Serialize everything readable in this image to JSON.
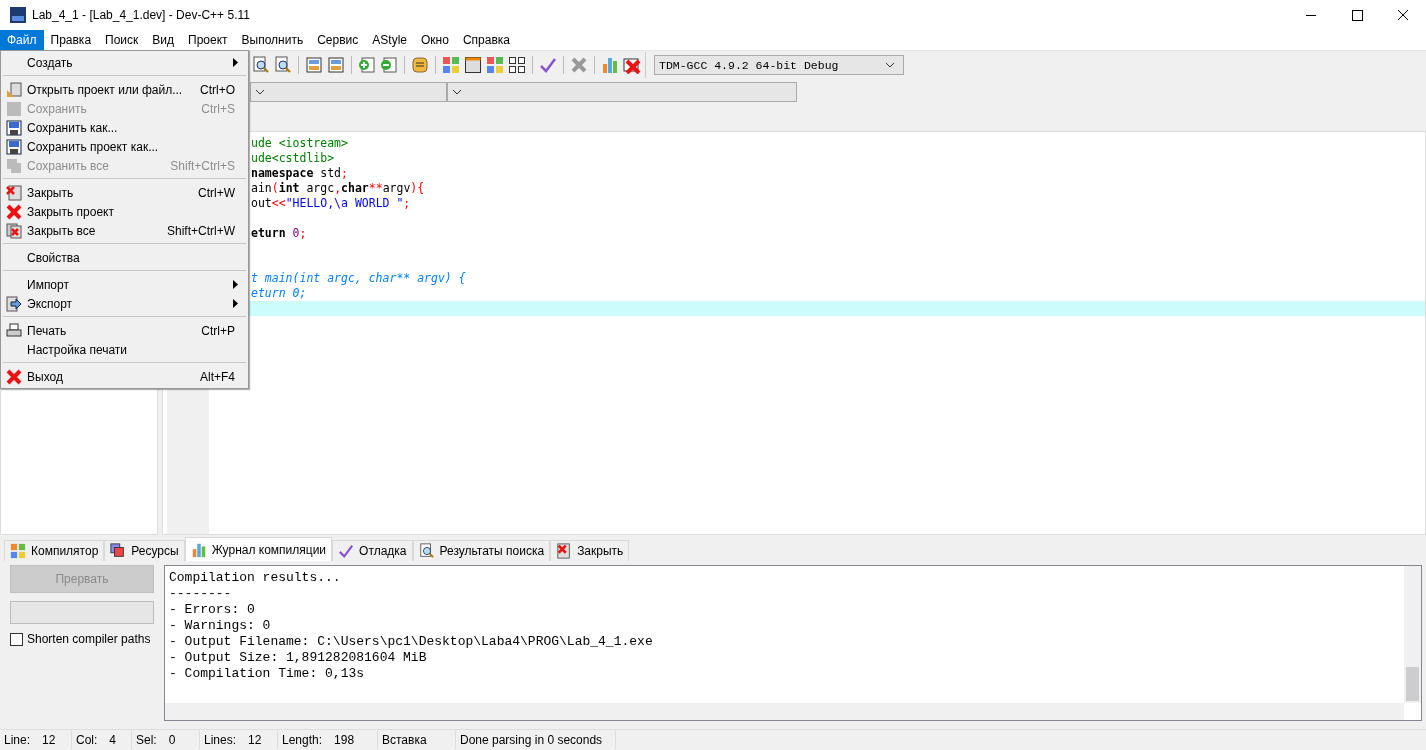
{
  "window": {
    "title": "Lab_4_1 - [Lab_4_1.dev] - Dev-C++ 5.11"
  },
  "menubar": [
    {
      "label": "Файл",
      "selected": true
    },
    {
      "label": "Правка",
      "selected": false
    },
    {
      "label": "Поиск",
      "selected": false
    },
    {
      "label": "Вид",
      "selected": false
    },
    {
      "label": "Проект",
      "selected": false
    },
    {
      "label": "Выполнить",
      "selected": false
    },
    {
      "label": "Сервис",
      "selected": false
    },
    {
      "label": "AStyle",
      "selected": false
    },
    {
      "label": "Окно",
      "selected": false
    },
    {
      "label": "Справка",
      "selected": false
    }
  ],
  "file_menu": [
    {
      "kind": "item",
      "label": "Создать",
      "disabled": false,
      "submenu": true
    },
    {
      "kind": "separator"
    },
    {
      "kind": "item",
      "label": "Открыть проект или файл...",
      "shortcut": "Ctrl+O",
      "disabled": false
    },
    {
      "kind": "item",
      "label": "Сохранить",
      "shortcut": "Ctrl+S",
      "disabled": true
    },
    {
      "kind": "item",
      "label": "Сохранить как...",
      "disabled": false
    },
    {
      "kind": "item",
      "label": "Сохранить проект как...",
      "disabled": false
    },
    {
      "kind": "item",
      "label": "Сохранить все",
      "shortcut": "Shift+Ctrl+S",
      "disabled": true
    },
    {
      "kind": "separator"
    },
    {
      "kind": "item",
      "label": "Закрыть",
      "shortcut": "Ctrl+W",
      "disabled": false
    },
    {
      "kind": "item",
      "label": "Закрыть проект",
      "disabled": false
    },
    {
      "kind": "item",
      "label": "Закрыть все",
      "shortcut": "Shift+Ctrl+W",
      "disabled": false
    },
    {
      "kind": "separator"
    },
    {
      "kind": "item",
      "label": "Свойства",
      "disabled": false
    },
    {
      "kind": "separator"
    },
    {
      "kind": "item",
      "label": "Импорт",
      "disabled": false,
      "submenu": true
    },
    {
      "kind": "item",
      "label": "Экспорт",
      "disabled": false,
      "submenu": true
    },
    {
      "kind": "separator"
    },
    {
      "kind": "item",
      "label": "Печать",
      "shortcut": "Ctrl+P",
      "disabled": false
    },
    {
      "kind": "item",
      "label": "Настройка печати",
      "disabled": false
    },
    {
      "kind": "separator"
    },
    {
      "kind": "item",
      "label": "Выход",
      "shortcut": "Alt+F4",
      "disabled": false
    }
  ],
  "toolbar": {
    "compiler": "TDM-GCC 4.9.2 64-bit Debug"
  },
  "editor": {
    "lines": [
      {
        "current": false,
        "tokens": [
          {
            "kind": "preproc",
            "text": "ude <iostream>"
          }
        ]
      },
      {
        "current": false,
        "tokens": [
          {
            "kind": "preproc",
            "text": "ude<cstdlib>"
          }
        ]
      },
      {
        "current": false,
        "tokens": [
          {
            "kind": "keyword",
            "text": "namespace"
          },
          {
            "kind": "plain",
            "text": " std"
          },
          {
            "kind": "symbol",
            "text": ";"
          }
        ]
      },
      {
        "current": false,
        "tokens": [
          {
            "kind": "plain",
            "text": "ain"
          },
          {
            "kind": "symbol",
            "text": "("
          },
          {
            "kind": "keyword",
            "text": "int"
          },
          {
            "kind": "plain",
            "text": " argc"
          },
          {
            "kind": "symbol",
            "text": ","
          },
          {
            "kind": "keyword",
            "text": "char"
          },
          {
            "kind": "symbol",
            "text": "**"
          },
          {
            "kind": "plain",
            "text": "argv"
          },
          {
            "kind": "symbol",
            "text": "){"
          }
        ]
      },
      {
        "current": false,
        "tokens": [
          {
            "kind": "plain",
            "text": "out"
          },
          {
            "kind": "symbol",
            "text": "<<"
          },
          {
            "kind": "string",
            "text": "\"HELLO,\\a WORLD \""
          },
          {
            "kind": "symbol",
            "text": ";"
          }
        ]
      },
      {
        "current": false
      },
      {
        "current": false,
        "tokens": [
          {
            "kind": "keyword",
            "text": "eturn"
          },
          {
            "kind": "number",
            "text": " 0"
          },
          {
            "kind": "symbol",
            "text": ";"
          }
        ]
      },
      {
        "current": false
      },
      {
        "current": false
      },
      {
        "current": false,
        "tokens": [
          {
            "kind": "comment",
            "text": "t main(int argc, char** argv) {"
          }
        ]
      },
      {
        "current": false,
        "tokens": [
          {
            "kind": "comment",
            "text": "eturn 0;"
          }
        ]
      },
      {
        "current": true
      }
    ]
  },
  "bottom_tabs": [
    {
      "label": "Компилятор",
      "selected": false
    },
    {
      "label": "Ресурсы",
      "selected": false
    },
    {
      "label": "Журнал компиляции",
      "selected": true
    },
    {
      "label": "Отладка",
      "selected": false
    },
    {
      "label": "Результаты поиска",
      "selected": false
    },
    {
      "label": "Закрыть",
      "selected": false
    }
  ],
  "compile_log": {
    "abort_button": {
      "label": "Прервать",
      "disabled": true
    },
    "progress": {
      "level": 0
    },
    "shorten_paths": {
      "label": "Shorten compiler paths",
      "checked": false
    },
    "lines": [
      "Compilation results...",
      "--------",
      "- Errors: 0",
      "- Warnings: 0",
      "- Output Filename: C:\\Users\\pc1\\Desktop\\Laba4\\PROG\\Lab_4_1.exe",
      "- Output Size: 1,891282081604 MiB",
      "- Compilation Time: 0,13s"
    ]
  },
  "status_bar": [
    {
      "label": "Line:",
      "value": "12"
    },
    {
      "label": "Col:",
      "value": "4"
    },
    {
      "label": "Sel:",
      "value": "0"
    },
    {
      "label": "Lines:",
      "value": "12"
    },
    {
      "label": "Length:",
      "value": "198"
    },
    {
      "value": "Вставка"
    },
    {
      "value": "Done parsing in 0 seconds"
    }
  ]
}
